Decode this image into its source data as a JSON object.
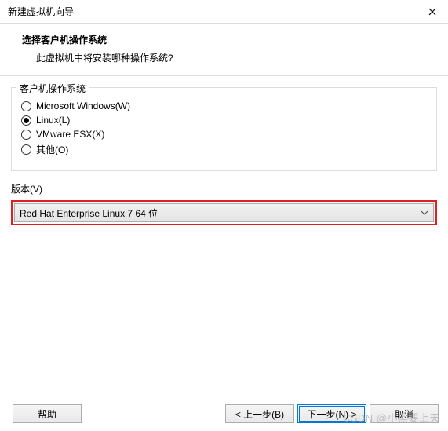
{
  "window": {
    "title": "新建虚拟机向导"
  },
  "header": {
    "title": "选择客户机操作系统",
    "subtitle": "此虚拟机中将安装哪种操作系统?"
  },
  "os_group": {
    "legend": "客户机操作系统",
    "options": [
      {
        "label": "Microsoft Windows(W)",
        "checked": false
      },
      {
        "label": "Linux(L)",
        "checked": true
      },
      {
        "label": "VMware ESX(X)",
        "checked": false
      },
      {
        "label": "其他(O)",
        "checked": false
      }
    ]
  },
  "version": {
    "label": "版本(V)",
    "selected": "Red Hat Enterprise Linux 7 64 位"
  },
  "footer": {
    "help": "帮助",
    "back": "< 上一步(B)",
    "next": "下一步(N) >",
    "cancel": "取消"
  },
  "watermark": "CSDN @小黑要上天"
}
